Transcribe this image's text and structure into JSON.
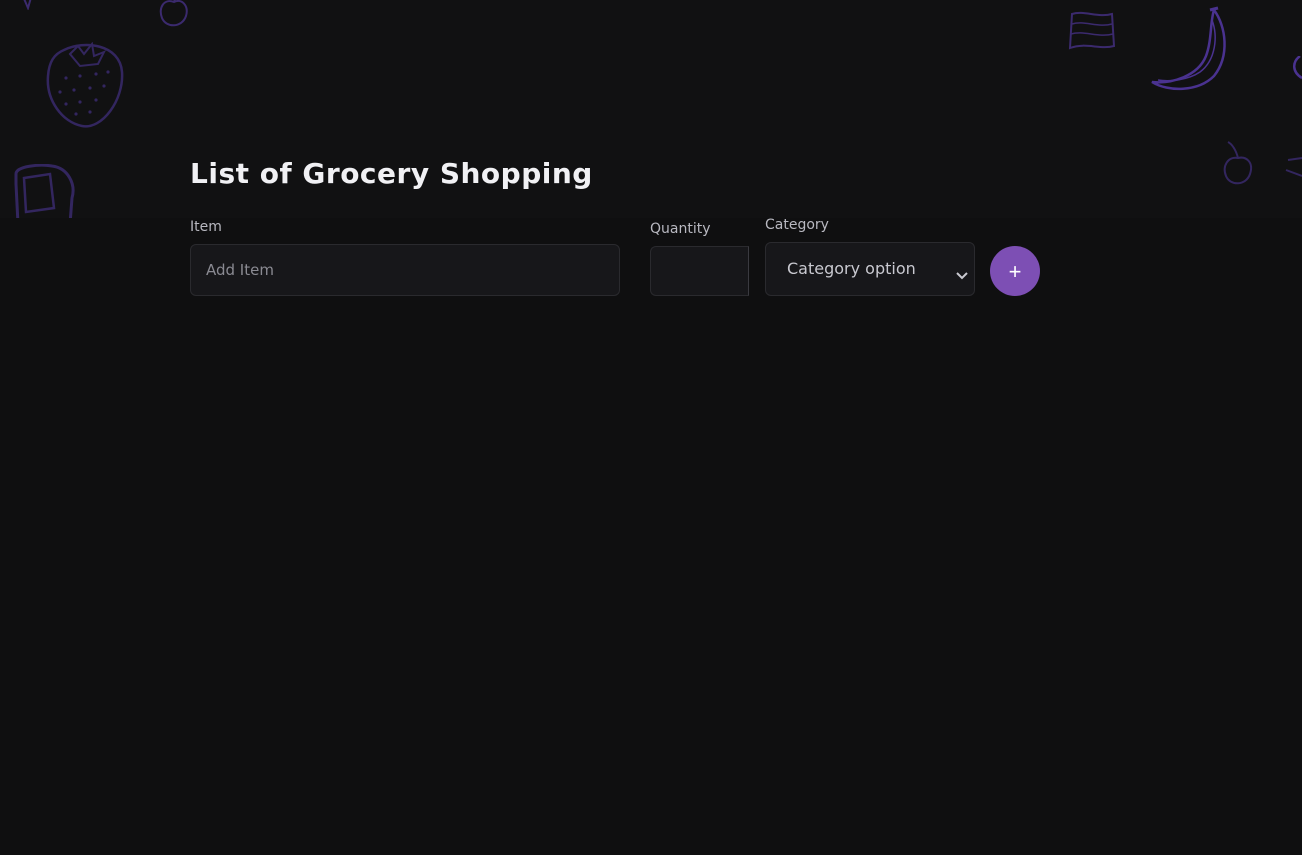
{
  "page": {
    "title": "List of Grocery Shopping"
  },
  "form": {
    "item": {
      "label": "Item",
      "placeholder": "Add Item",
      "value": ""
    },
    "quantity": {
      "label": "Quantity",
      "value": ""
    },
    "category": {
      "label": "Category",
      "selected": "Category option"
    },
    "add_button": {
      "label": "+",
      "color": "#7d4fb4"
    }
  },
  "decor": {
    "icons": [
      "strawberry-icon",
      "apple-icon",
      "bread-icon",
      "bacon-icon",
      "banana-icon",
      "cherry-icon"
    ],
    "doodle_color": "#3b2a6e"
  }
}
